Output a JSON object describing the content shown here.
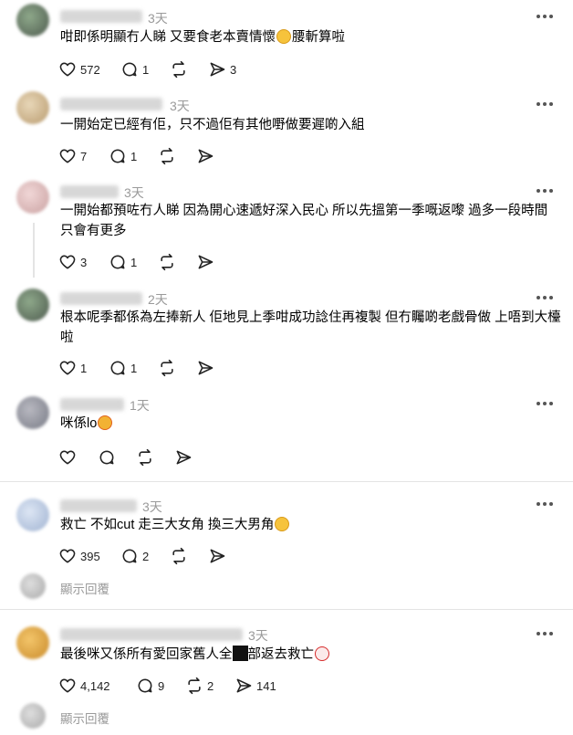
{
  "ui": {
    "show_replies_label": "顯示回覆"
  },
  "posts": [
    {
      "username": "seoWkchan",
      "time": "3天",
      "text_a": "咁即係明顯冇人睇 又要食老本賣情懷",
      "emoji_a": "rofl-emoji",
      "text_b": "腰斬算啦",
      "likes": "572",
      "replies": "1",
      "reposts": "",
      "shares": "3"
    },
    {
      "username": "jessie.fung",
      "time": "3天",
      "text_a": "一開始定已經有佢，只不過佢有其他嘢做要遲啲入組",
      "likes": "7",
      "replies": "1",
      "reposts": "",
      "shares": ""
    },
    {
      "username": "ks",
      "time": "3天",
      "text_a": "一開始都預咗冇人睇 因為開心速遞好深入民心 所以先搵第一季嘅返嚟 過多一段時間 只會有更多",
      "likes": "3",
      "replies": "1",
      "reposts": "",
      "shares": ""
    },
    {
      "username": "seoWkchan",
      "time": "2天",
      "text_a": "根本呢季都係為左捧新人 佢地見上季咁成功諗住再複製 但冇矚啲老戲骨做 上唔到大檯啦",
      "likes": "1",
      "replies": "1",
      "reposts": "",
      "shares": ""
    },
    {
      "username": "kerfu",
      "time": "1天",
      "text_a": "咪係lo",
      "emoji_a": "fire-emoji",
      "likes": "",
      "replies": "",
      "reposts": "",
      "shares": ""
    },
    {
      "username": "tohoh.cope",
      "time": "3天",
      "text_a": "救亡 不如cut 走三大女角 換三大男角",
      "emoji_a": "laughing-emoji",
      "likes": "395",
      "replies": "2",
      "reposts": "",
      "shares": ""
    },
    {
      "username": "pineapple.buzz",
      "time": "3天",
      "text_a": "最後咪又係所有愛回家舊人全",
      "text_b": "部返去救亡",
      "emoji_a": "clown-emoji",
      "likes": "4,142",
      "replies": "9",
      "reposts": "2",
      "shares": "141"
    }
  ],
  "colors": {
    "muted": "#9a9a9a",
    "divider": "#e4e4e4",
    "icon": "#222222"
  }
}
